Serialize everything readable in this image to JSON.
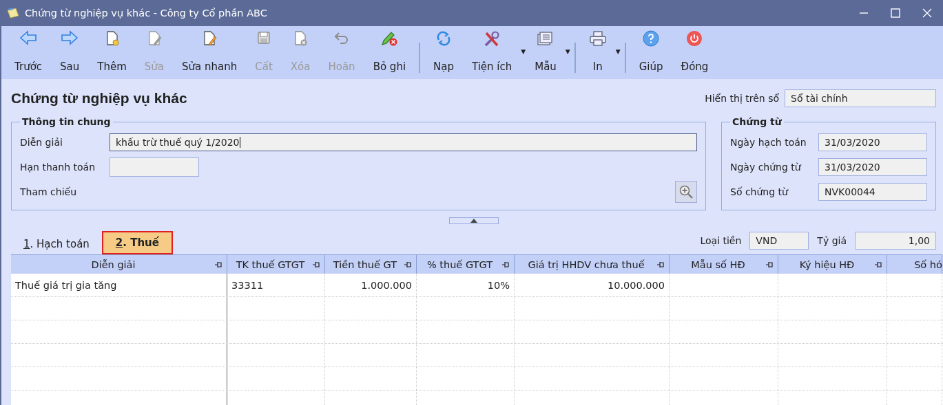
{
  "window": {
    "title": "Chứng từ nghiệp vụ khác - Công ty Cổ phần ABC"
  },
  "toolbar": [
    {
      "items": [
        {
          "label": "Trước",
          "disabled": false
        },
        {
          "label": "Sau",
          "disabled": false
        },
        {
          "label": "Thêm",
          "disabled": false
        },
        {
          "label": "Sửa",
          "disabled": true
        },
        {
          "label": "Sửa nhanh",
          "disabled": false
        },
        {
          "label": "Cất",
          "disabled": true
        },
        {
          "label": "Xóa",
          "disabled": true
        },
        {
          "label": "Hoãn",
          "disabled": true
        },
        {
          "label": "Bỏ ghi",
          "disabled": false
        }
      ]
    },
    {
      "items": [
        {
          "label": "Nạp",
          "disabled": false
        },
        {
          "label": "Tiện ích",
          "disabled": false,
          "caret": "▼"
        },
        {
          "label": "Mẫu",
          "disabled": false,
          "caret": "▼"
        }
      ]
    },
    {
      "items": [
        {
          "label": "In",
          "disabled": false,
          "caret": "▼"
        }
      ]
    },
    {
      "items": [
        {
          "label": "Giúp",
          "disabled": false
        },
        {
          "label": "Đóng",
          "disabled": false
        }
      ]
    }
  ],
  "heading": "Chứng từ nghiệp vụ khác",
  "ledger": {
    "label": "Hiển thị trên sổ",
    "value": "Sổ tài chính"
  },
  "general": {
    "legend": "Thông tin chung",
    "description": {
      "label": "Diễn giải",
      "value": "khấu trừ thuế quý 1/2020"
    },
    "due_date": {
      "label": "Hạn thanh toán"
    },
    "reference": {
      "label": "Tham chiếu"
    }
  },
  "voucher": {
    "legend": "Chứng từ",
    "fields": [
      {
        "label": "Ngày hạch toán",
        "value": "31/03/2020"
      },
      {
        "label": "Ngày chứng từ",
        "value": "31/03/2020"
      },
      {
        "label": "Số chứng từ",
        "value": "NVK00044"
      }
    ]
  },
  "tabs": [
    {
      "label": "1. Hạch toán",
      "selected": false
    },
    {
      "label": "2. Thuế",
      "selected": true
    }
  ],
  "currency": {
    "label": "Loại tiền",
    "value": "VND"
  },
  "rate": {
    "label": "Tỷ giá",
    "value": "1,00"
  },
  "table": {
    "columns": [
      "Diễn giải",
      "TK thuế GTGT",
      "Tiền thuế GT",
      "% thuế GTGT",
      "Giá trị HHDV chưa thuế",
      "Mẫu số HĐ",
      "Ký hiệu HĐ",
      "Số hó"
    ],
    "rows": [
      [
        "Thuế giá trị gia tăng",
        "33311",
        "1.000.000",
        "10%",
        "10.000.000",
        "",
        "",
        ""
      ]
    ]
  }
}
